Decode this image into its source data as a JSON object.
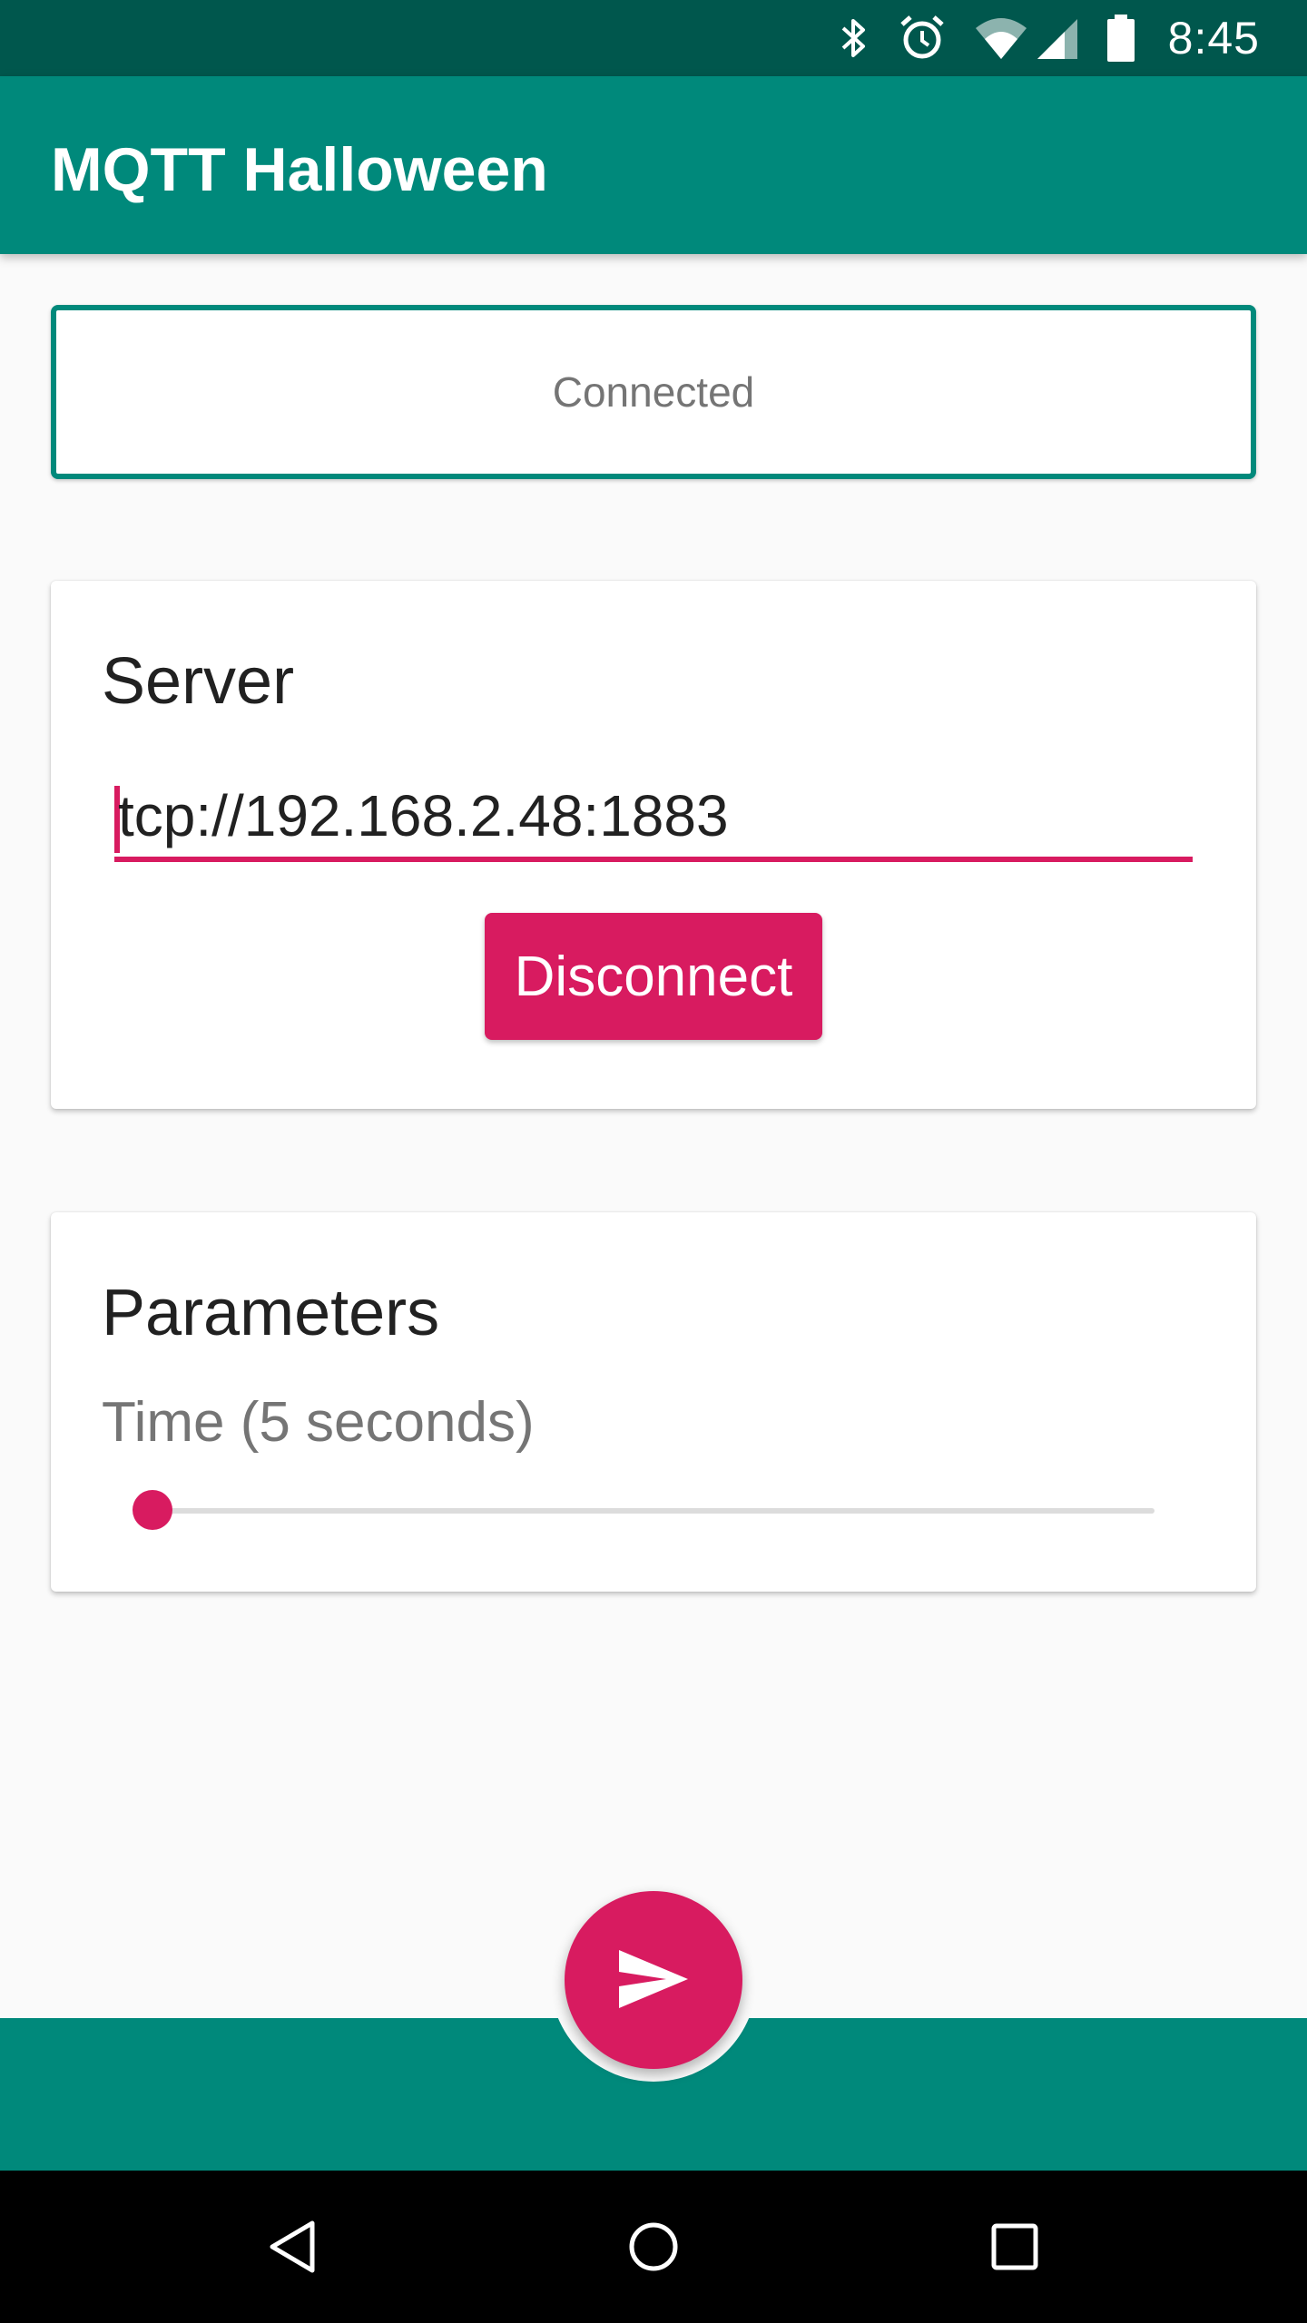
{
  "status_bar": {
    "time": "8:45",
    "icons": [
      "bluetooth-icon",
      "alarm-icon",
      "wifi-icon",
      "signal-icon",
      "battery-icon"
    ]
  },
  "app_bar": {
    "title": "MQTT Halloween"
  },
  "connection": {
    "status": "Connected"
  },
  "server_card": {
    "title": "Server",
    "server_value": "tcp://192.168.2.48:1883",
    "disconnect_label": "Disconnect"
  },
  "params_card": {
    "title": "Parameters",
    "time_label": "Time (5 seconds)",
    "slider_fraction": 0.0
  },
  "fab": {
    "icon": "send-icon"
  },
  "nav": {
    "icons": [
      "back-icon",
      "home-icon",
      "recents-icon"
    ]
  },
  "colors": {
    "primary": "#00897b",
    "primary_dark": "#00574d",
    "accent": "#d81b60"
  }
}
